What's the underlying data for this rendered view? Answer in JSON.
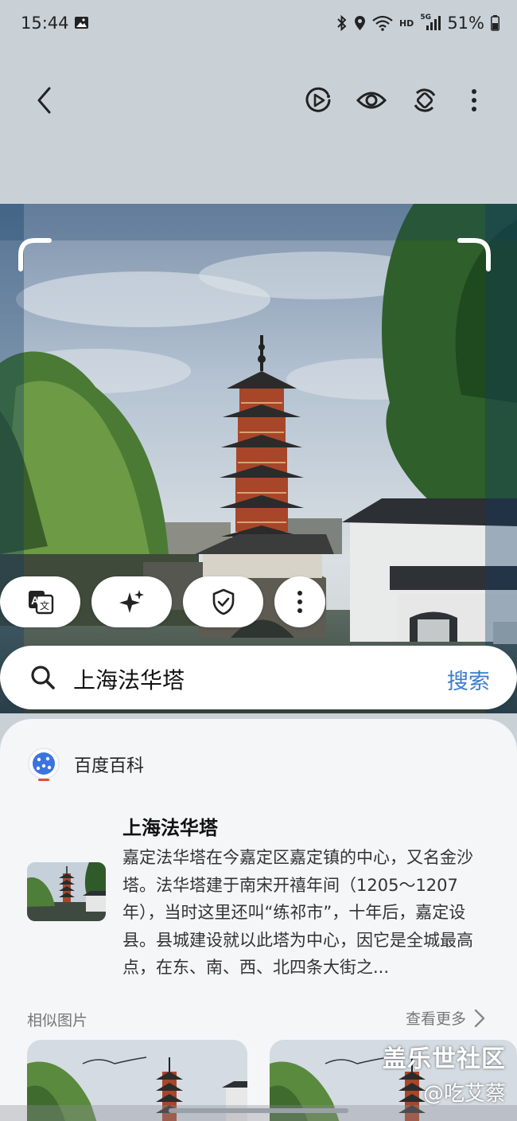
{
  "status_bar": {
    "time": "15:44",
    "network_label": "HD",
    "signal_label": "5G",
    "battery": "51%",
    "icons": [
      "gallery-icon",
      "bluetooth-icon",
      "location-icon",
      "wifi-icon",
      "signal-icon",
      "battery-icon"
    ]
  },
  "toolbar": {
    "icons": [
      "back-icon",
      "motion-photo-icon",
      "eye-icon",
      "rotate-icon",
      "more-vert-icon"
    ]
  },
  "actions": {
    "icons": [
      "translate-icon",
      "sparkle-icon",
      "shield-check-icon",
      "more-vert-icon"
    ]
  },
  "search": {
    "query": "上海法华塔",
    "button_label": "搜索"
  },
  "result": {
    "source": "百度百科",
    "title": "上海法华塔",
    "description": "嘉定法华塔在今嘉定区嘉定镇的中心，又名金沙塔。法华塔建于南宋开禧年间（1205～1207年），当时这里还叫“练祁市”，十年后，嘉定设县。县城建设就以此塔为中心，因它是全城最高点，在东、南、西、北四条大街之..."
  },
  "similar": {
    "label": "相似图片",
    "see_more": "查看更多"
  },
  "watermark": {
    "line1": "盖乐世社区",
    "line2": "@吃艾蔡"
  },
  "colors": {
    "accent": "#3c7bd0",
    "pagoda_red": "#a8462a"
  }
}
